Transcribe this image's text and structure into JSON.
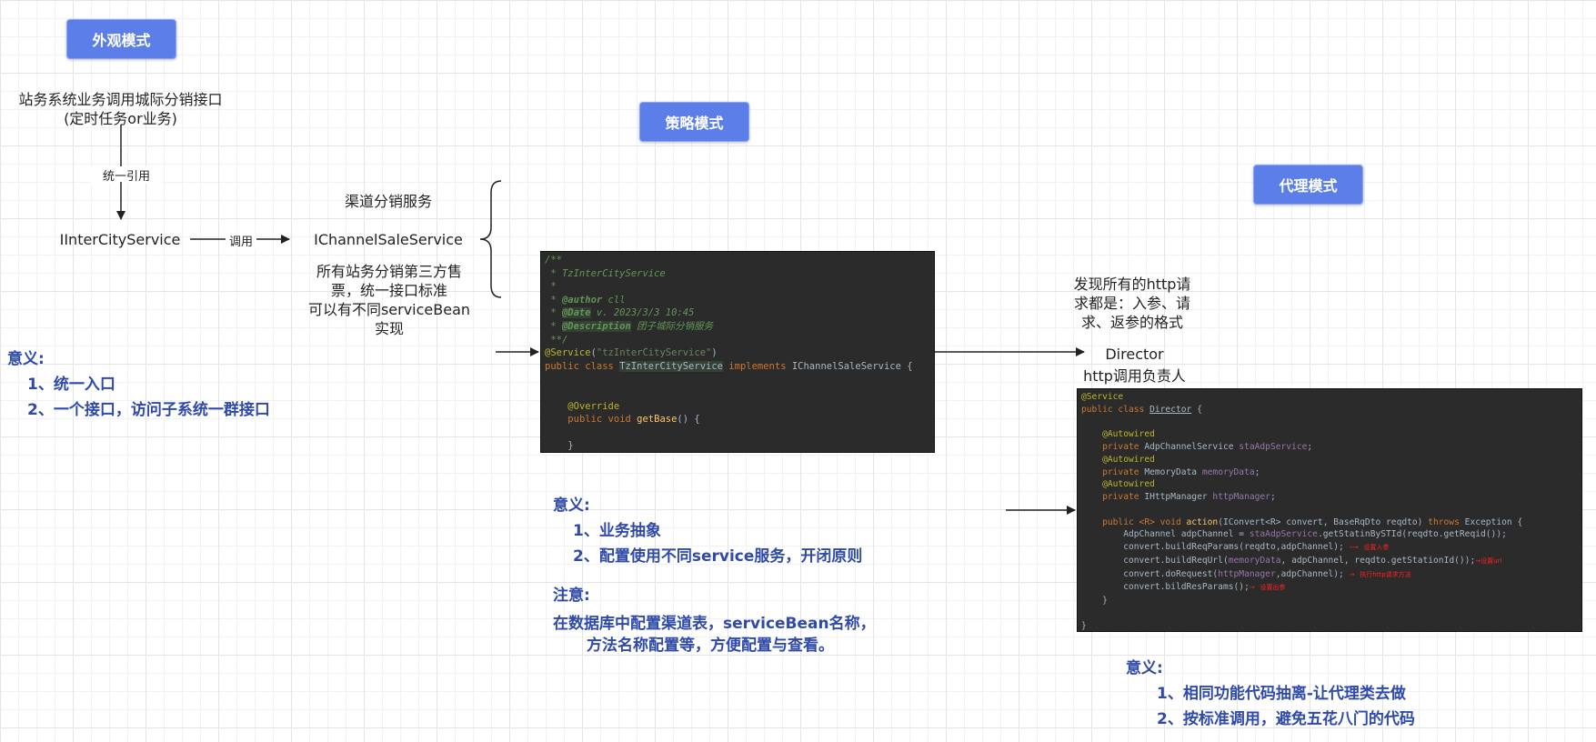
{
  "facade": {
    "label": "外观模式",
    "caller_line1": "站务系统业务调用城际分销接口",
    "caller_line2": "(定时任务or业务)",
    "unify_ref": "统一引用",
    "interface_name": "IInterCityService",
    "call_label": "调用",
    "meaning_title": "意义:",
    "meaning_items": [
      "1、统一入口",
      "2、一个接口，访问子系统一群接口"
    ]
  },
  "strategy": {
    "label": "策略模式",
    "channel_title": "渠道分销服务",
    "channel_service": "IChannelSaleService",
    "desc_line1": "所有站务分销第三方售",
    "desc_line2": "票，统一接口标准",
    "desc_line3": "可以有不同serviceBean",
    "desc_line4": "实现",
    "code": {
      "l1": "/**",
      "l2": " * TzInterCityService",
      "l3": " *",
      "l4_tag": "@author",
      "l4_val": " cll",
      "l5_tag": "@Date",
      "l5_val": " v. 2023/3/3 10:45",
      "l6_tag": "@Description",
      "l6_val": " 团子城际分销服务",
      "l7": " **/",
      "l8_ann": "@Service",
      "l8_str": "\"tzInterCityService\"",
      "l9_kw": "public class ",
      "l9_cls": "TzInterCityService",
      "l9_kw2": " implements ",
      "l9_iface": "IChannelSaleService {",
      "l10_ann": "@Override",
      "l11_kw": "public void ",
      "l11_fn": "getBase",
      "l11_rest": "() {",
      "l12": "}"
    },
    "meaning_title": "意义:",
    "meaning_items": [
      "1、业务抽象",
      "2、配置使用不同service服务，开闭原则"
    ],
    "note_title": "注意:",
    "note_line1": "在数据库中配置渠道表，serviceBean名称，",
    "note_line2": "方法名称配置等，方便配置与查看。"
  },
  "proxy": {
    "label": "代理模式",
    "finding_line1": "发现所有的http请",
    "finding_line2": "求都是：入参、请",
    "finding_line3": "求、返参的格式",
    "director_line1": "Director",
    "director_line2": "http调用负责人",
    "code": {
      "ann1": "@Service",
      "cls_kw": "public class ",
      "cls_name": "Director",
      "cls_rest": " {",
      "aw": "@Autowired",
      "f1_kw": "private ",
      "f1_type": "AdpChannelService ",
      "f1_name": "staAdpService",
      "f2_type": "MemoryData ",
      "f2_name": "memoryData",
      "f3_type": "IHttpManager ",
      "f3_name": "httpManager",
      "m_kw": "public <R> void ",
      "m_fn": "action",
      "m_rest": "(IConvert<R> convert, BaseRqDto reqdto) ",
      "m_throws": "throws ",
      "m_exc": "Exception {",
      "s1": "AdpChannel adpChannel = ",
      "s1_fld": "staAdpService",
      "s1_rest": ".getStatinBySTId(reqdto.getReqid());",
      "s2": "convert.buildReqParams(reqdto,adpChannel);",
      "s2_note": "设置入参",
      "s3a": "convert.buildReqUrl(",
      "s3_fld": "memoryData",
      "s3b": ", adpChannel, reqdto.getStationId());",
      "s3_note": "设置url",
      "s4a": "convert.doRequest(",
      "s4_fld": "httpManager",
      "s4b": ",adpChannel);",
      "s4_note": "执行http请求方法",
      "s5": "convert.bildResParams();",
      "s5_note": "设置出参",
      "close1": "}",
      "close2": "}"
    },
    "meaning_title": "意义:",
    "meaning_items": [
      "1、相同功能代码抽离-让代理类去做",
      "2、按标准调用，避免五花八门的代码"
    ]
  }
}
